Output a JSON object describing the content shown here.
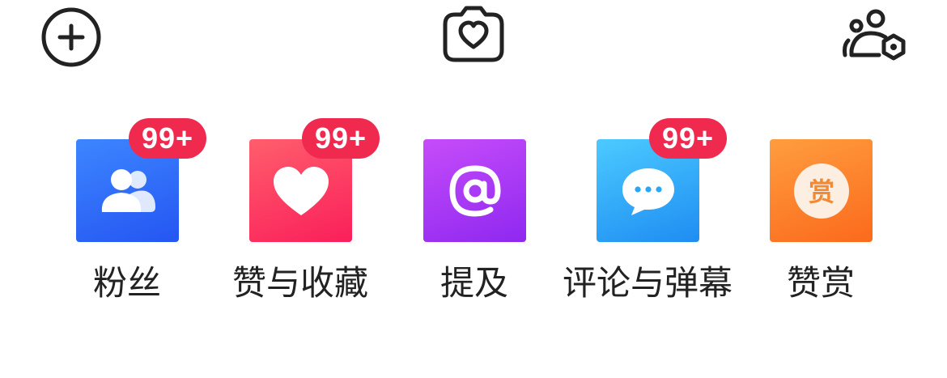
{
  "header": {
    "add_icon": "plus-circle-icon",
    "camera_icon": "camera-heart-icon",
    "settings_icon": "user-settings-icon"
  },
  "shortcuts": [
    {
      "label": "粉丝",
      "badge": "99+",
      "icon": "users-icon",
      "color": "#2f6bf6"
    },
    {
      "label": "赞与收藏",
      "badge": "99+",
      "icon": "heart-icon",
      "color": "#fb2a5c"
    },
    {
      "label": "提及",
      "badge": "",
      "icon": "at-icon",
      "color": "#a236f5"
    },
    {
      "label": "评论与弹幕",
      "badge": "99+",
      "icon": "chat-bubble-icon",
      "color": "#2aa6f8"
    },
    {
      "label": "赞赏",
      "badge": "",
      "icon": "reward-icon",
      "color": "#fb7c25",
      "icon_text": "赏"
    }
  ],
  "colors": {
    "badge": "#f0294f",
    "label_text": "#222222",
    "icon_stroke": "#222222"
  }
}
